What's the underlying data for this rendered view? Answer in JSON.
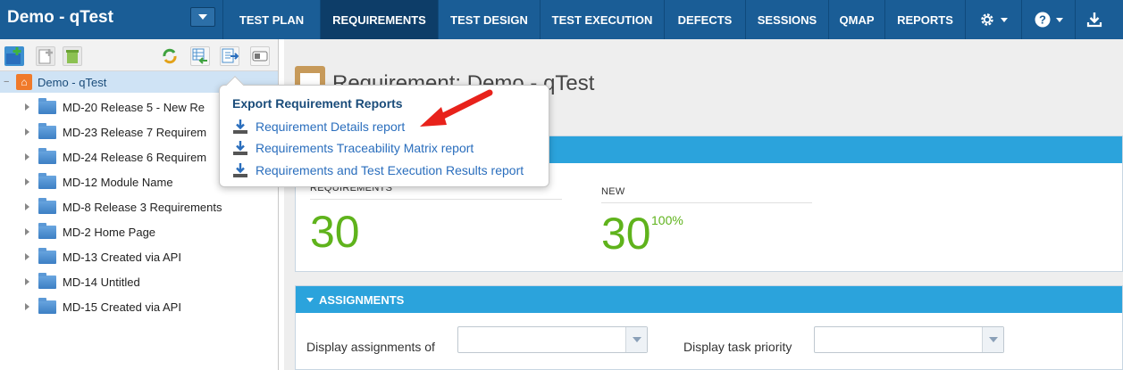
{
  "app": {
    "title": "Demo - qTest"
  },
  "nav": {
    "tabs": [
      {
        "label": "TEST PLAN",
        "active": false
      },
      {
        "label": "REQUIREMENTS",
        "active": true
      },
      {
        "label": "TEST DESIGN",
        "active": false
      },
      {
        "label": "TEST EXECUTION",
        "active": false
      },
      {
        "label": "DEFECTS",
        "active": false
      },
      {
        "label": "SESSIONS",
        "active": false
      },
      {
        "label": "QMAP",
        "active": false
      },
      {
        "label": "REPORTS",
        "active": false
      }
    ],
    "icons": [
      "gear-icon",
      "help-icon",
      "download-icon"
    ]
  },
  "tree": {
    "root": "Demo - qTest",
    "items": [
      "MD-20 Release 5 - New Re",
      "MD-23 Release 7 Requirem",
      "MD-24 Release 6 Requirem",
      "MD-12 Module Name",
      "MD-8 Release 3 Requirements",
      "MD-2 Home Page",
      "MD-13 Created via API",
      "MD-14 Untitled",
      "MD-15 Created via API"
    ]
  },
  "main": {
    "title": "Requirement: Demo - qTest",
    "stats": {
      "requirements_label": "REQUIREMENTS",
      "requirements_value": "30",
      "new_label": "NEW",
      "new_value": "30",
      "new_pct": "100%"
    },
    "assignments": {
      "header": "ASSIGNMENTS",
      "display_assignments_label": "Display assignments of",
      "display_priority_label": "Display task priority"
    }
  },
  "popup": {
    "title": "Export Requirement Reports",
    "items": [
      "Requirement Details report",
      "Requirements Traceability Matrix report",
      "Requirements and Test Execution Results report"
    ]
  },
  "colors": {
    "nav_bg": "#1a5d96",
    "nav_active": "#0d3d68",
    "panel_header": "#2ba3dc",
    "stat_green": "#5fb31c",
    "link_blue": "#2a6ebd",
    "annotation_arrow": "#e8221b"
  }
}
